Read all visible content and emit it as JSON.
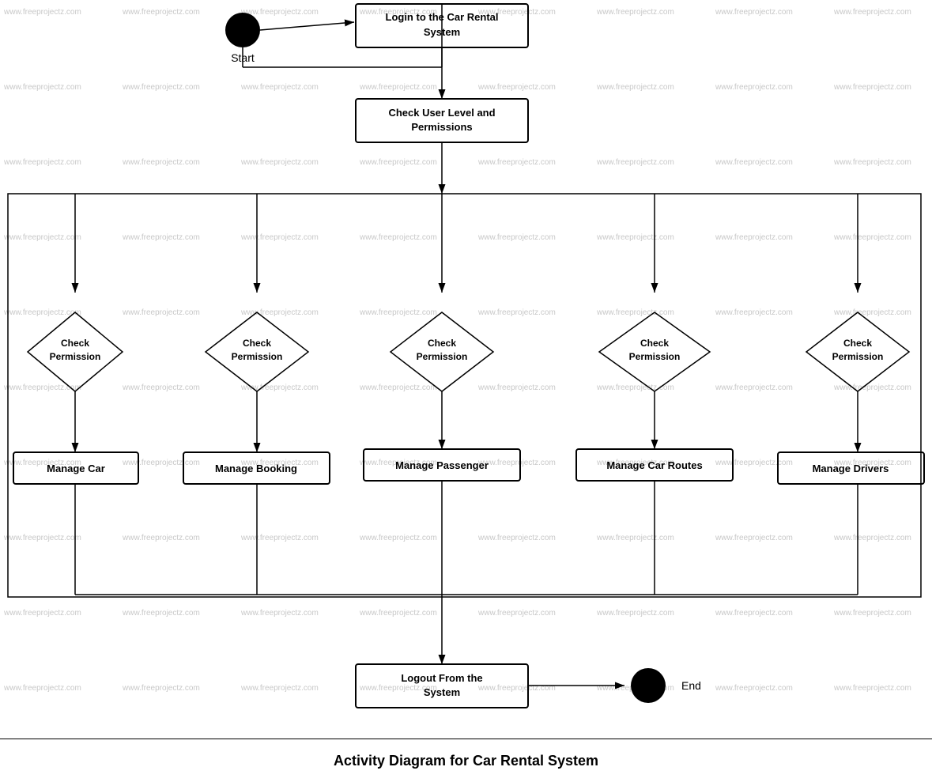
{
  "diagram": {
    "title": "Activity Diagram for Car Rental System",
    "watermark": "www.freeprojectz.com",
    "nodes": {
      "start": "Start",
      "login": "Login to the Car Rental System",
      "checkUserLevel": "Check User Level and Permissions",
      "checkPerm1": "Check Permission",
      "checkPerm2": "Check Permission",
      "checkPerm3": "Check Permission",
      "checkPerm4": "Check Permission",
      "checkPerm5": "Check Permission",
      "manageCar": "Manage Car",
      "manageBooking": "Manage Booking",
      "managePassenger": "Manage Passenger",
      "manageCarRoutes": "Manage Car Routes",
      "manageDrivers": "Manage Drivers",
      "logout": "Logout From the System",
      "end": "End"
    }
  }
}
